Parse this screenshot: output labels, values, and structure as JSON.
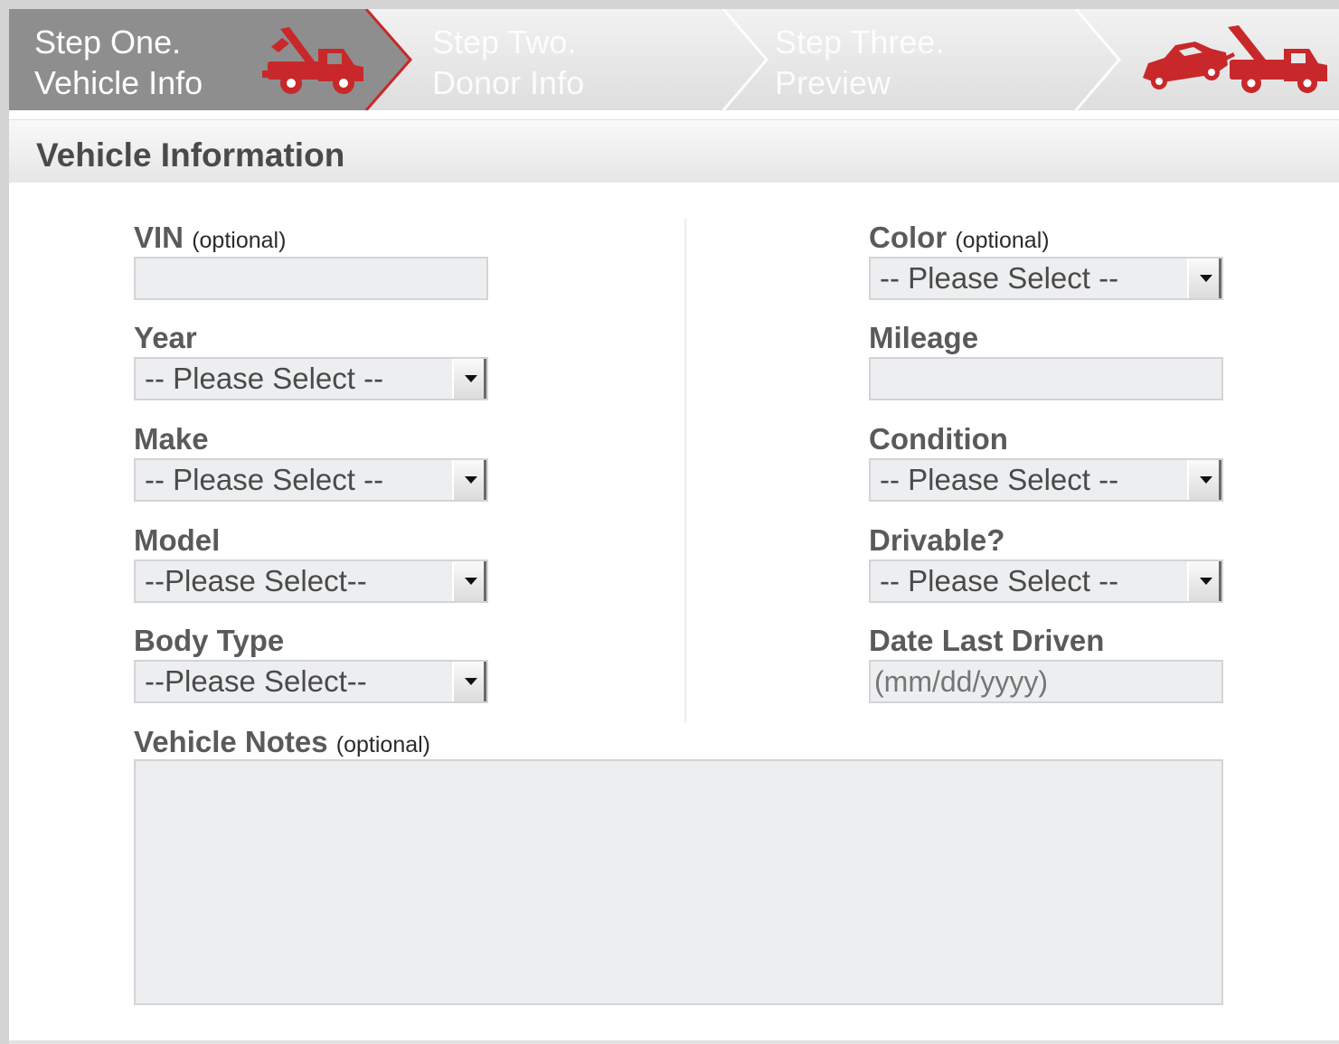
{
  "steps": [
    {
      "number": "Step One.",
      "name": "Vehicle Info",
      "active": true
    },
    {
      "number": "Step Two.",
      "name": "Donor Info",
      "active": false
    },
    {
      "number": "Step Three.",
      "name": "Preview",
      "active": false
    }
  ],
  "colors": {
    "active_step": "#8c8c8c",
    "accent": "#c8282a",
    "inactive_bg": "#e4e4e4"
  },
  "section_title": "Vehicle Information",
  "form": {
    "vin": {
      "label": "VIN",
      "note": "(optional)",
      "value": ""
    },
    "year": {
      "label": "Year",
      "selected": "-- Please Select --"
    },
    "make": {
      "label": "Make",
      "selected": "-- Please Select --"
    },
    "model": {
      "label": "Model",
      "selected": "--Please Select--"
    },
    "body_type": {
      "label": "Body Type",
      "selected": "--Please Select--"
    },
    "color": {
      "label": "Color",
      "note": "(optional)",
      "selected": "-- Please Select --"
    },
    "mileage": {
      "label": "Mileage",
      "value": ""
    },
    "condition": {
      "label": "Condition",
      "selected": "-- Please Select --"
    },
    "drivable": {
      "label": "Drivable?",
      "selected": "-- Please Select --"
    },
    "date_last_driven": {
      "label": "Date Last Driven",
      "placeholder": "(mm/dd/yyyy)"
    },
    "vehicle_notes": {
      "label": "Vehicle Notes",
      "note": "(optional)",
      "value": ""
    }
  },
  "icons": {
    "active_step_icon": "tow-truck-icon",
    "brand_icon": "tow-truck-towing-car-icon"
  }
}
